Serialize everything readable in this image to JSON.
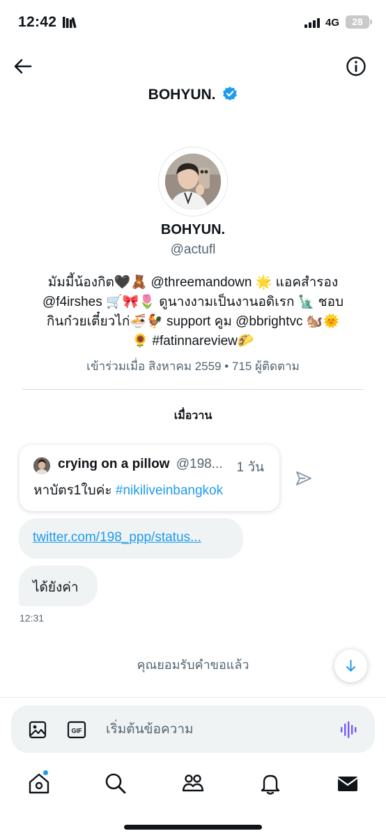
{
  "status_bar": {
    "time": "12:42",
    "network": "4G",
    "battery": "28"
  },
  "header": {
    "title": "BOHYUN."
  },
  "profile": {
    "name": "BOHYUN.",
    "handle": "@actufl",
    "bio_lines": [
      "มัมมี้น้องกิต🖤🧸 @threemandown 🌟 แอคสำรอง",
      "@f4irshes 🛒🎀🌷 ดูนางงามเป็นงานอดิเรก 🗽 ชอบ",
      "กินก๋วยเตี๋ยวไก่🍜🐓 support คูม @bbrightvc 🐿️🌞",
      "🌻 #fatinnareview🌮"
    ],
    "meta": "เข้าร่วมเมื่อ สิงหาคม 2559 • 715 ผู้ติดตาม"
  },
  "conversation": {
    "date_label": "เมื่อวาน",
    "quoted_tweet": {
      "author_name": "crying on a pillow",
      "author_handle": "@198...",
      "time": "1 วัน",
      "text": "หาบัตร1ใบค่ะ ",
      "hashtag": "#nikiliveinbangkok"
    },
    "link_message": "twitter.com/198_ppp/status...",
    "reply_message": "ได้ยังค่า",
    "reply_time": "12:31",
    "accepted_notice": "คุณยอมรับคำขอแล้ว"
  },
  "composer": {
    "placeholder": "เริ่มต้นข้อความ",
    "gif_label": "GIF"
  },
  "colors": {
    "accent": "#1d9bf0",
    "voice": "#7856ff",
    "bubble": "#eff3f4",
    "muted": "#536471"
  }
}
